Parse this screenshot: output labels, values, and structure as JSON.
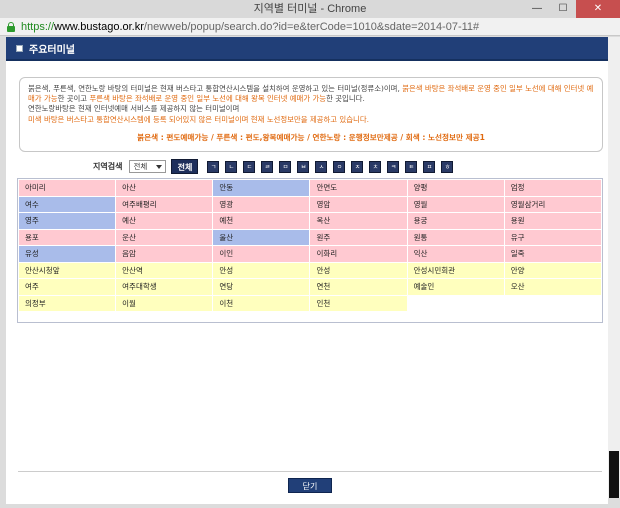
{
  "window": {
    "title": "지역별 터미널 - Chrome",
    "minimize": "—",
    "maximize": "☐",
    "close": "✕"
  },
  "address": {
    "scheme": "https://",
    "host": "www.bustago.or.kr",
    "path": "/newweb/popup/search.do?id=e&terCode=1010&sdate=2014-07-11#"
  },
  "header": {
    "title": "주요터미널"
  },
  "notice": {
    "p1_black": "붉은색, 푸른색, 연한노랑 바탕의 터미널은 현재 버스타고 통합연산시스템을 설치하여 운영하고 있는 터미널(정류소)이며, ",
    "p1_orange": "붉은색 바탕은 좌석배로 운영 중인 일부 노선에 대해 인터넷 예매가 가능",
    "p1_black2": "한 곳이고 ",
    "p1_orange2": "푸른색 바탕은 좌석배로 운영 중인 일부 노선에 대해 왕복 인터넷 예매가 가능",
    "p1_black3": "한 곳입니다.",
    "p2": "연한노랑바탕은 현재 인터넷예매 서비스를 제공하지 않는 터미널이며",
    "p3": "미색 바탕은 버스타고 통합연산시스템에 등록 되어있지 않은 터미널이며 현재 노선정보만을 제공하고 있습니다.",
    "legend": "붉은색 : 편도예매가능 / 푸른색 : 편도,왕복예매가능 / 연한노랑 : 운행정보만제공 / 회색 : 노선정보만 제공1"
  },
  "filter": {
    "label": "지역검색",
    "select_value": "전체",
    "all_button": "전체",
    "consonants": [
      "ㄱ",
      "ㄴ",
      "ㄷ",
      "ㄹ",
      "ㅁ",
      "ㅂ",
      "ㅅ",
      "ㅇ",
      "ㅈ",
      "ㅊ",
      "ㅋ",
      "ㅌ",
      "ㅍ",
      "ㅎ"
    ]
  },
  "terminals": {
    "rows": [
      [
        {
          "name": "아미리",
          "type": "pink"
        },
        {
          "name": "아산",
          "type": "pink"
        },
        {
          "name": "안동",
          "type": "blue"
        },
        {
          "name": "안면도",
          "type": "pink"
        },
        {
          "name": "양평",
          "type": "pink"
        },
        {
          "name": "엄정",
          "type": "pink"
        }
      ],
      [
        {
          "name": "여수",
          "type": "blue"
        },
        {
          "name": "여주배평리",
          "type": "pink"
        },
        {
          "name": "영광",
          "type": "pink"
        },
        {
          "name": "영암",
          "type": "pink"
        },
        {
          "name": "영월",
          "type": "pink"
        },
        {
          "name": "영월삼거리",
          "type": "pink"
        }
      ],
      [
        {
          "name": "영주",
          "type": "blue"
        },
        {
          "name": "예산",
          "type": "pink"
        },
        {
          "name": "예천",
          "type": "pink"
        },
        {
          "name": "옥산",
          "type": "pink"
        },
        {
          "name": "용궁",
          "type": "pink"
        },
        {
          "name": "용원",
          "type": "pink"
        }
      ],
      [
        {
          "name": "용포",
          "type": "pink"
        },
        {
          "name": "운산",
          "type": "pink"
        },
        {
          "name": "울산",
          "type": "blue"
        },
        {
          "name": "원주",
          "type": "pink"
        },
        {
          "name": "원통",
          "type": "pink"
        },
        {
          "name": "유구",
          "type": "pink"
        }
      ],
      [
        {
          "name": "유성",
          "type": "blue"
        },
        {
          "name": "음암",
          "type": "pink"
        },
        {
          "name": "이인",
          "type": "pink"
        },
        {
          "name": "이화리",
          "type": "pink"
        },
        {
          "name": "익산",
          "type": "pink"
        },
        {
          "name": "일죽",
          "type": "pink"
        }
      ],
      [
        {
          "name": "안산시청앞",
          "type": "yellow"
        },
        {
          "name": "안산역",
          "type": "yellow"
        },
        {
          "name": "안성",
          "type": "yellow"
        },
        {
          "name": "안성",
          "type": "yellow"
        },
        {
          "name": "안성시민회관",
          "type": "yellow"
        },
        {
          "name": "안양",
          "type": "yellow"
        }
      ],
      [
        {
          "name": "여주",
          "type": "yellow"
        },
        {
          "name": "여주대학생",
          "type": "yellow"
        },
        {
          "name": "연당",
          "type": "yellow"
        },
        {
          "name": "연천",
          "type": "yellow"
        },
        {
          "name": "예술인",
          "type": "yellow"
        },
        {
          "name": "오산",
          "type": "yellow"
        }
      ],
      [
        {
          "name": "의정부",
          "type": "yellow"
        },
        {
          "name": "이월",
          "type": "yellow"
        },
        {
          "name": "이천",
          "type": "yellow"
        },
        {
          "name": "인천",
          "type": "yellow"
        },
        {
          "name": "",
          "type": "white"
        },
        {
          "name": "",
          "type": "white"
        }
      ]
    ]
  },
  "footer": {
    "close_button": "닫기"
  },
  "colors": {
    "header": "#213f78",
    "pink": "#ffc9d1",
    "blue": "#a9bcea",
    "yellow": "#ffffbe",
    "notice_orange": "#e06a10"
  }
}
